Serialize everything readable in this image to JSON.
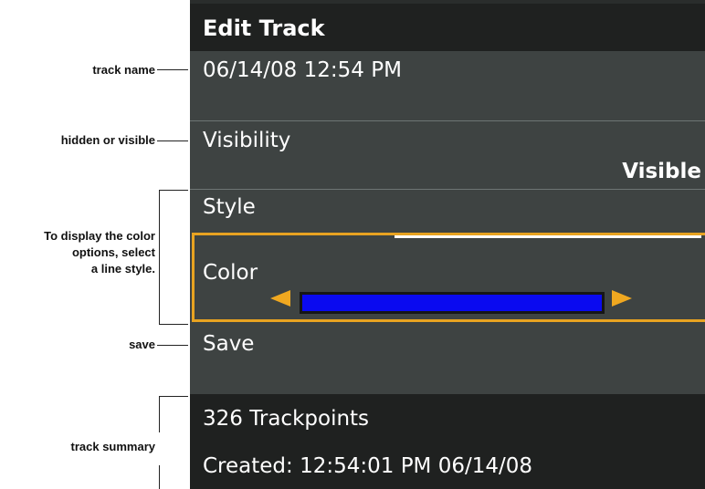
{
  "callouts": {
    "track_name": "track name",
    "visibility": "hidden or visible",
    "color_line1": "To display the color",
    "color_line2": "options, select",
    "color_line3": "a line style.",
    "save": "save",
    "summary": "track summary"
  },
  "screen": {
    "title": "Edit Track",
    "track_name": "06/14/08 12:54 PM",
    "visibility_label": "Visibility",
    "visibility_value": "Visible",
    "style_label": "Style",
    "color_label": "Color",
    "color_value": "#0a0af0",
    "accent_color": "#e8a321",
    "save_label": "Save",
    "trackpoints": "326 Trackpoints",
    "created": "Created: 12:54:01 PM 06/14/08"
  },
  "icons": {
    "color_prev": "arrow-left-icon",
    "color_next": "arrow-right-icon"
  }
}
